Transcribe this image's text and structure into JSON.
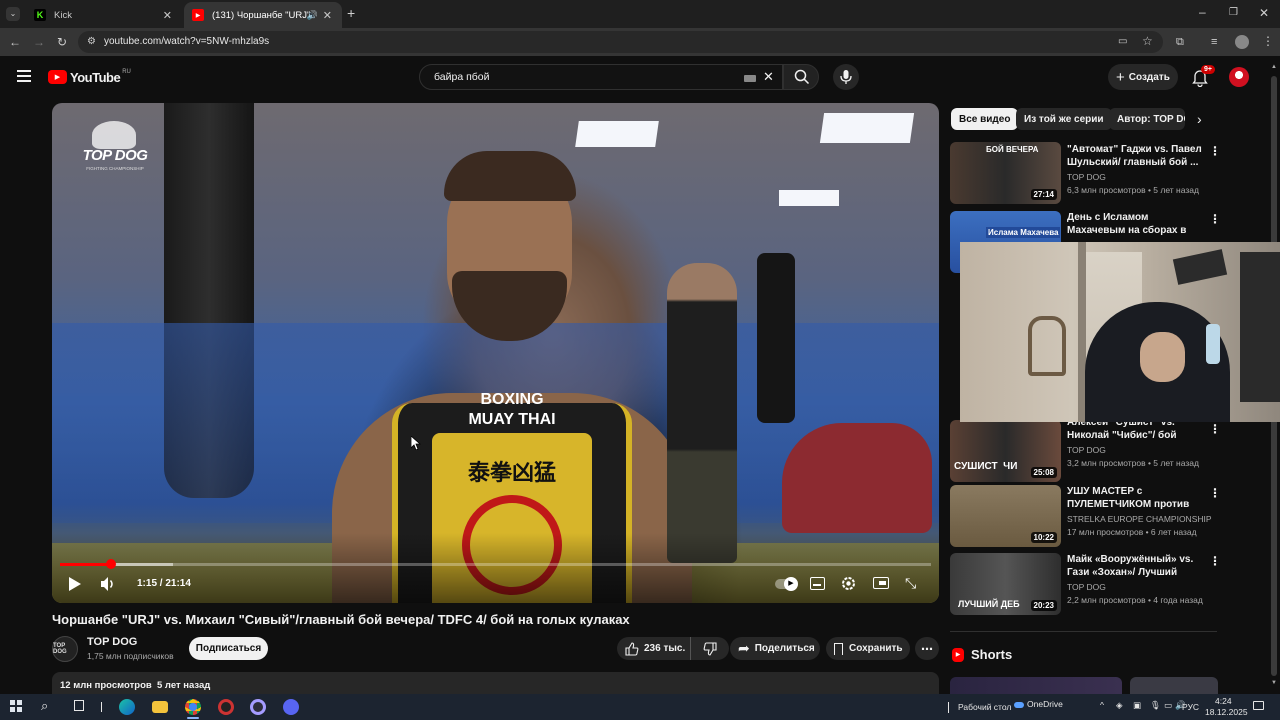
{
  "browser": {
    "tabs": [
      {
        "title": "Kick",
        "icon": "kick-icon"
      },
      {
        "title": "(131) Чоршанбе \"URJ\" vs. М",
        "icon": "youtube-icon"
      }
    ],
    "url": "youtube.com/watch?v=5NW-mhzla9s"
  },
  "youtube": {
    "logo_text": "YouTube",
    "region": "RU",
    "search_query": "байра пбой",
    "create_label": "Создать",
    "notifications": "9+"
  },
  "player": {
    "time": "1:15 / 21:14",
    "progress": 0.059,
    "loaded": 0.13,
    "overlay_logo": "TOP DOG",
    "overlay_logo_sub": "FIGHTING CHAMPIONSHIP",
    "shirt_text_1": "BOXING",
    "shirt_text_2": "MUAY THAI",
    "shirt_text_3": "泰拳凶猛"
  },
  "video": {
    "title": "Чоршанбе \"URJ\" vs. Михаил \"Сивый\"/главный бой вечера/ TDFC 4/ бой на голых кулаках",
    "channel": "TOP DOG",
    "subscribers": "1,75 млн подписчиков",
    "subscribe_label": "Подписаться",
    "likes": "236 тыс.",
    "share_label": "Поделиться",
    "save_label": "Сохранить",
    "views_meta": "12 млн просмотров  5 лет назад"
  },
  "sidebar": {
    "chips": [
      "Все видео",
      "Из той же серии",
      "Автор: TOP DOG"
    ],
    "items": [
      {
        "title": "\"Автомат\" Гаджи vs. Павел Шульский/ главный бой ...",
        "channel": "TOP DOG",
        "meta": "6,3 млн просмотров • 5 лет назад",
        "duration": "27:14",
        "thumb_text": "БОЙ ВЕЧЕРА"
      },
      {
        "title": "День с Исламом Махачевым на сборах в Сильди | VLOG",
        "channel": "",
        "meta": "",
        "duration": "",
        "thumb_text": "Ислама Махачева"
      },
      {
        "title": "Алексей \"Сушист\" vs. Николай \"Чибис\"/ бой вечера/ TDFC 5...",
        "channel": "TOP DOG",
        "meta": "3,2 млн просмотров • 5 лет назад",
        "duration": "25:08",
        "thumb_text": "СУШИСТ  ЧИ"
      },
      {
        "title": "УШУ МАСТЕР с ПУЛЕМЕТЧИКОМ против Дв...",
        "channel": "STRELKA EUROPE CHAMPIONSHIP",
        "meta": "17 млн просмотров • 6 лет назад",
        "duration": "10:22",
        "thumb_text": ""
      },
      {
        "title": "Майк «Вооружённый» vs. Гази «Зохан»/ Лучший дебют/ ...",
        "channel": "TOP DOG",
        "meta": "2,2 млн просмотров • 4 года назад",
        "duration": "20:23",
        "thumb_text": "ЛУЧШИЙ ДЕБ"
      }
    ],
    "shorts_label": "Shorts"
  },
  "taskbar": {
    "desktop_label": "Рабочий стол",
    "onedrive_label": "OneDrive",
    "lang": "РУС",
    "time": "4:24",
    "date": "18.12.2025"
  }
}
